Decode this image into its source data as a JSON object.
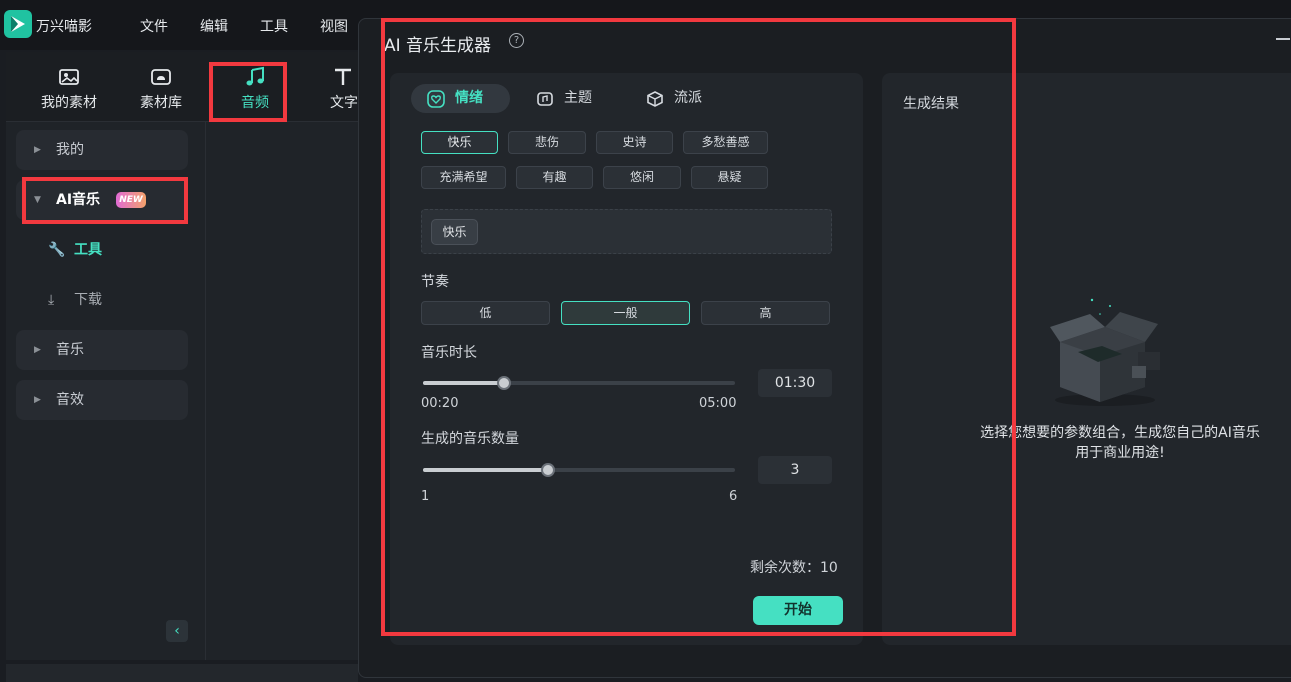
{
  "app": {
    "name": "万兴喵影",
    "brand_color": "#20c3a1"
  },
  "menu": {
    "items": [
      "文件",
      "编辑",
      "工具",
      "视图"
    ]
  },
  "media_tabs": [
    {
      "label": "我的素材",
      "icon": "image-icon"
    },
    {
      "label": "素材库",
      "icon": "cloud-icon"
    },
    {
      "label": "音频",
      "icon": "music-note-icon",
      "active": true
    },
    {
      "label": "文字",
      "icon": "text-icon"
    }
  ],
  "sidebar": {
    "my": "我的",
    "ai_music": "AI音乐",
    "new_badge": "NEW",
    "tools": "工具",
    "download": "下载",
    "music": "音乐",
    "sfx": "音效"
  },
  "dialog": {
    "title": "AI 音乐生成器",
    "tabs": [
      {
        "label": "情绪",
        "icon": "heart-icon",
        "active": true
      },
      {
        "label": "主题",
        "icon": "music-card-icon"
      },
      {
        "label": "流派",
        "icon": "cube-icon"
      }
    ],
    "moods_row1": [
      "快乐",
      "悲伤",
      "史诗",
      "多愁善感"
    ],
    "moods_row2": [
      "充满希望",
      "有趣",
      "悠闲",
      "悬疑"
    ],
    "selected_mood": "快乐",
    "tempo_label": "节奏",
    "tempo_options": [
      "低",
      "一般",
      "高"
    ],
    "tempo_selected": "一般",
    "duration": {
      "label": "音乐时长",
      "min_label": "00:20",
      "max_label": "05:00",
      "value_label": "01:30",
      "fraction": 0.26
    },
    "count": {
      "label": "生成的音乐数量",
      "min_label": "1",
      "max_label": "6",
      "value_label": "3",
      "fraction": 0.4
    },
    "remaining": "剩余次数：10",
    "start": "开始",
    "result_title": "生成结果",
    "empty_line1": "选择您想要的参数组合，生成您自己的AI音乐",
    "empty_line2": "用于商业用途!"
  },
  "colors": {
    "accent": "#45e0c2",
    "highlight": "#f2393f"
  }
}
